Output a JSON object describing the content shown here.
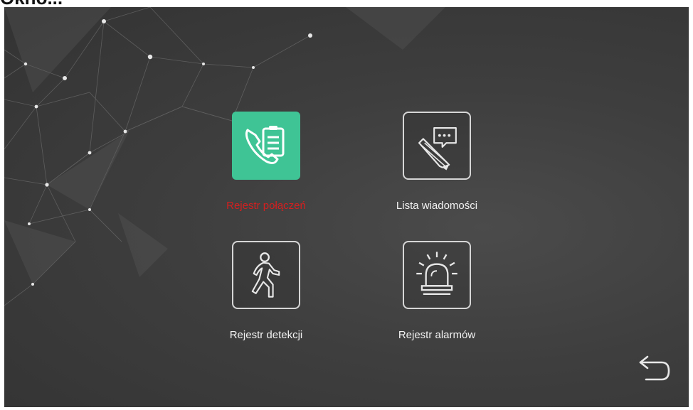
{
  "window": {
    "title": "Okno..."
  },
  "menu": {
    "items": [
      {
        "label": "Rejestr połączeń",
        "icon": "call-log-icon",
        "state": "selected"
      },
      {
        "label": "Lista wiadomości",
        "icon": "message-edit-icon",
        "state": "normal"
      },
      {
        "label": "Rejestr detekcji",
        "icon": "motion-person-icon",
        "state": "normal"
      },
      {
        "label": "Rejestr alarmów",
        "icon": "alarm-siren-icon",
        "state": "normal"
      }
    ]
  },
  "controls": {
    "back_icon": "back-arrow-icon"
  },
  "colors": {
    "selected_tile": "#3fc495",
    "selected_label": "#d41f1f",
    "label": "#f2f2f2",
    "background": "#3e3e3e"
  }
}
